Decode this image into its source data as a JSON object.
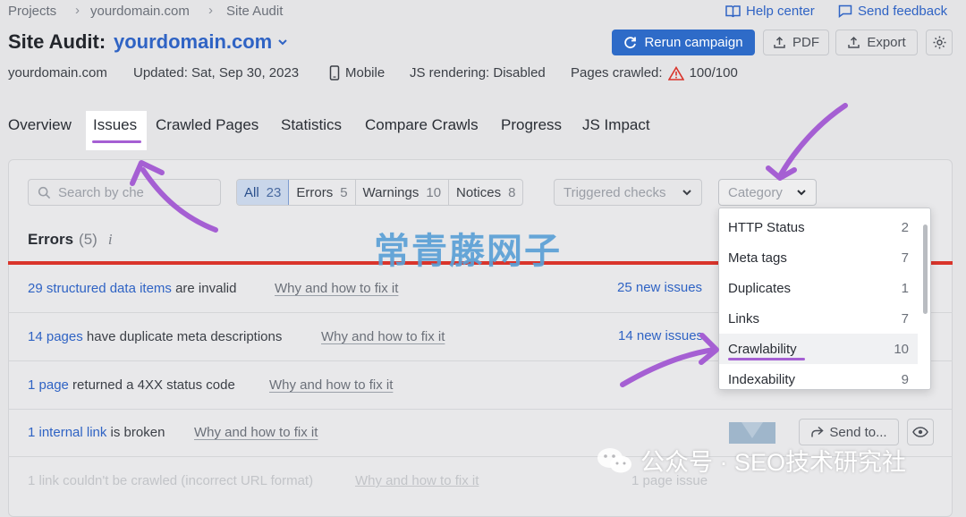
{
  "breadcrumb": {
    "items": [
      "Projects",
      "yourdomain.com",
      "Site Audit"
    ]
  },
  "header_links": {
    "help": "Help center",
    "feedback": "Send feedback"
  },
  "title": {
    "label": "Site Audit:",
    "domain": "yourdomain.com"
  },
  "actions": {
    "rerun": "Rerun campaign",
    "pdf": "PDF",
    "export": "Export"
  },
  "meta": {
    "domain": "yourdomain.com",
    "updated": "Updated: Sat, Sep 30, 2023",
    "device": "Mobile",
    "js": "JS rendering: Disabled",
    "pages_label": "Pages crawled:",
    "pages_value": "100/100"
  },
  "tabs": [
    "Overview",
    "Issues",
    "Crawled Pages",
    "Statistics",
    "Compare Crawls",
    "Progress",
    "JS Impact"
  ],
  "filters": {
    "search_placeholder": "Search by che",
    "segments": [
      {
        "label": "All",
        "count": "23"
      },
      {
        "label": "Errors",
        "count": "5"
      },
      {
        "label": "Warnings",
        "count": "10"
      },
      {
        "label": "Notices",
        "count": "8"
      }
    ],
    "triggered": "Triggered checks",
    "category": "Category"
  },
  "errors": {
    "title": "Errors",
    "count": "(5)",
    "info": "i"
  },
  "rows": [
    {
      "link": "29 structured data items",
      "text": " are invalid",
      "fix": "Why and how to fix it",
      "new": "25 new issues"
    },
    {
      "link": "14 pages",
      "text": " have duplicate meta descriptions",
      "fix": "Why and how to fix it",
      "new": "14 new issues"
    },
    {
      "link": "1 page",
      "text": " returned a 4XX status code",
      "fix": "Why and how to fix it",
      "new": ""
    },
    {
      "link": "1 internal link",
      "text": " is broken",
      "fix": "Why and how to fix it",
      "new": ""
    },
    {
      "link": "",
      "text": "1 link couldn't be crawled (incorrect URL format)",
      "fix": "Why and how to fix it",
      "new": "1 page issue"
    }
  ],
  "category_menu": [
    {
      "label": "HTTP Status",
      "count": "2"
    },
    {
      "label": "Meta tags",
      "count": "7"
    },
    {
      "label": "Duplicates",
      "count": "1"
    },
    {
      "label": "Links",
      "count": "7"
    },
    {
      "label": "Crawlability",
      "count": "10"
    },
    {
      "label": "Indexability",
      "count": "9"
    }
  ],
  "send_to": "Send to...",
  "overlays": {
    "watermark": "常青藤网子",
    "wechat": "公众号 · SEO技术研究社"
  },
  "colors": {
    "accent": "#2e6bc8",
    "error": "#d9342b",
    "highlight": "#a55fd3"
  }
}
